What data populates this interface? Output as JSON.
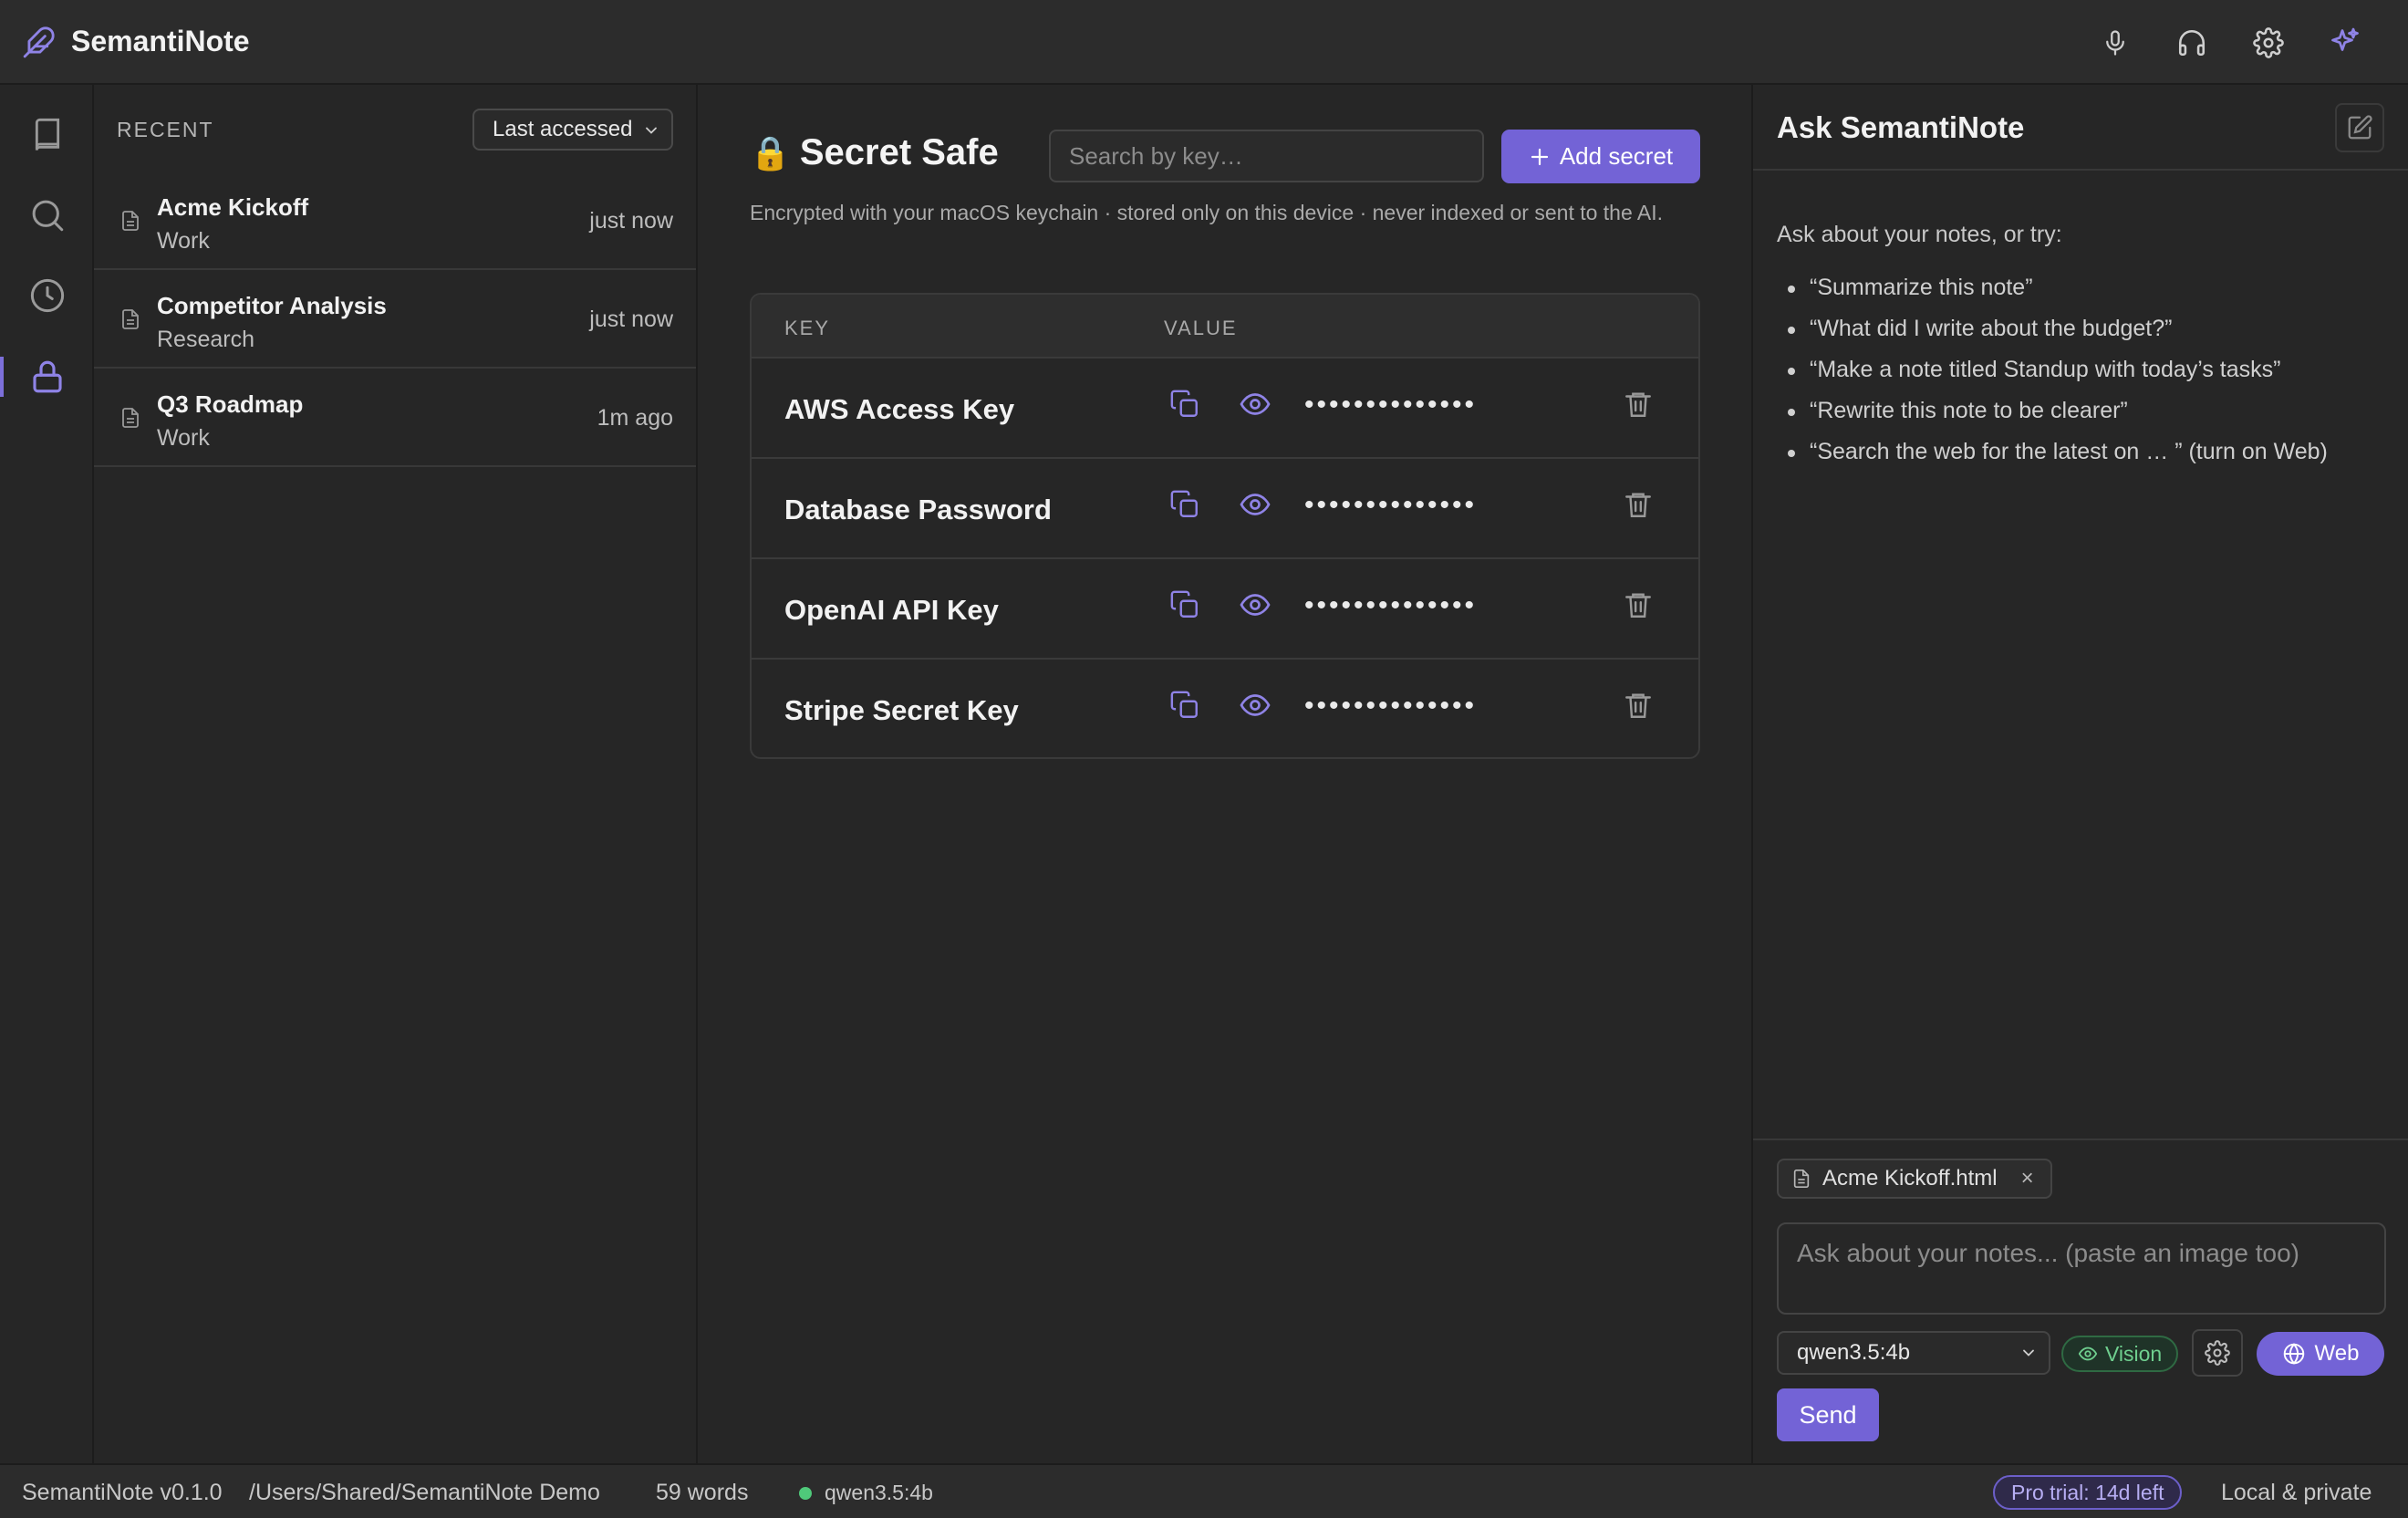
{
  "app": {
    "title": "SemantiNote"
  },
  "topbar": {
    "icons": [
      "microphone-icon",
      "headphones-icon",
      "gear-icon",
      "sparkles-icon"
    ]
  },
  "rail": {
    "items": [
      "notebook-icon",
      "search-icon",
      "clock-icon",
      "lock-icon"
    ],
    "active": "lock-icon"
  },
  "recent": {
    "label": "RECENT",
    "sort_value": "Last accessed",
    "notes": [
      {
        "title": "Acme Kickoff",
        "folder": "Work",
        "time": "just now"
      },
      {
        "title": "Competitor Analysis",
        "folder": "Research",
        "time": "just now"
      },
      {
        "title": "Q3 Roadmap",
        "folder": "Work",
        "time": "1m ago"
      }
    ]
  },
  "safe": {
    "lock_glyph": "🔒",
    "title": "Secret Safe",
    "search_placeholder": "Search by key…",
    "add_label": "Add secret",
    "description": "Encrypted with your macOS keychain · stored only on this device · never indexed or sent to the AI.",
    "col_key": "KEY",
    "col_value": "VALUE",
    "mask": "••••••••••••••",
    "secrets": [
      {
        "key": "AWS Access Key"
      },
      {
        "key": "Database Password"
      },
      {
        "key": "OpenAI API Key"
      },
      {
        "key": "Stripe Secret Key"
      }
    ]
  },
  "ask": {
    "title": "Ask SemantiNote",
    "intro": "Ask about your notes, or try:",
    "tips": [
      "“Summarize this note”",
      "“What did I write about the budget?”",
      "“Make a note titled Standup with today’s tasks”",
      "“Rewrite this note to be clearer”",
      "“Search the web for the latest on … ” (turn on Web)"
    ],
    "attachment": "Acme Kickoff.html",
    "attachment_remove": "×",
    "input_placeholder": "Ask about your notes... (paste an image too)",
    "model": "qwen3.5:4b",
    "vision_label": "Vision",
    "web_label": "Web",
    "send_label": "Send"
  },
  "status": {
    "version": "SemantiNote v0.1.0",
    "path": "/Users/Shared/SemantiNote Demo",
    "words": "59 words",
    "model": "qwen3.5:4b",
    "trial": "Pro trial: 14d left",
    "privacy": "Local & private"
  },
  "colors": {
    "accent": "#7363d6",
    "online": "#4fc97a",
    "vision": "#6fcf8f"
  }
}
